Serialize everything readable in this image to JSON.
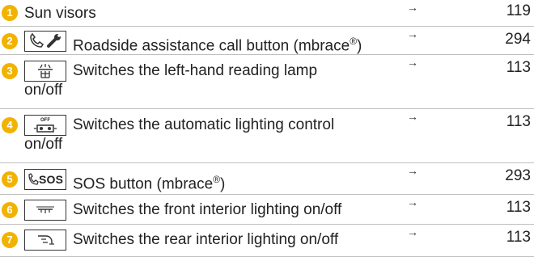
{
  "rows": [
    {
      "number": "1",
      "text": "Sun visors",
      "arrow": "→",
      "page": "119"
    },
    {
      "number": "2",
      "text": "Roadside assistance call button (mbrace",
      "reg": "®",
      "text_end": ")",
      "arrow": "→",
      "page": "294",
      "icon": "phone-wrench-icon"
    },
    {
      "number": "3",
      "text_line1": "Switches the left-hand reading lamp",
      "text_line2": "on/off",
      "arrow": "→",
      "page": "113",
      "icon": "reading-lamp-icon"
    },
    {
      "number": "4",
      "text_line1": "Switches the automatic lighting control",
      "text_line2": "on/off",
      "arrow": "→",
      "page": "113",
      "icon": "auto-lighting-off-icon",
      "icon_label": "OFF"
    },
    {
      "number": "5",
      "text": "SOS button (mbrace",
      "reg": "®",
      "text_end": ")",
      "arrow": "→",
      "page": "293",
      "icon": "sos-phone-icon",
      "icon_label": "SOS"
    },
    {
      "number": "6",
      "text": "Switches the front interior lighting on/off",
      "arrow": "→",
      "page": "113",
      "icon": "front-interior-light-icon"
    },
    {
      "number": "7",
      "text": "Switches the rear interior lighting on/off",
      "arrow": "→",
      "page": "113",
      "icon": "rear-interior-light-icon"
    }
  ],
  "colors": {
    "badge": "#f1b300",
    "rule": "#bfbfbf"
  }
}
